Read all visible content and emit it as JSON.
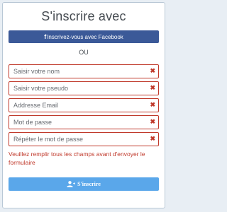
{
  "form": {
    "title": "S'inscrire avec",
    "facebook_icon": "f",
    "facebook_label": "Inscrivez-vous avec Facebook",
    "or_label": "OU",
    "fields": [
      {
        "placeholder": "Saisir votre nom",
        "value": ""
      },
      {
        "placeholder": "Saisir votre pseudo",
        "value": ""
      },
      {
        "placeholder": "Addresse Email",
        "value": ""
      },
      {
        "placeholder": "Mot de passe",
        "value": ""
      },
      {
        "placeholder": "Répéter le mot de passe",
        "value": ""
      }
    ],
    "field_error_icon": "✖",
    "error_message": "Veuillez remplir tous les champs avant d'envoyer le formulaire",
    "submit_label": "S'inscrire"
  },
  "colors": {
    "facebook": "#3b5998",
    "error": "#c0392b",
    "submit": "#5aa7ea"
  },
  "icons": {
    "facebook": "facebook-icon",
    "clear": "close-icon",
    "submit": "user-plus-icon"
  }
}
